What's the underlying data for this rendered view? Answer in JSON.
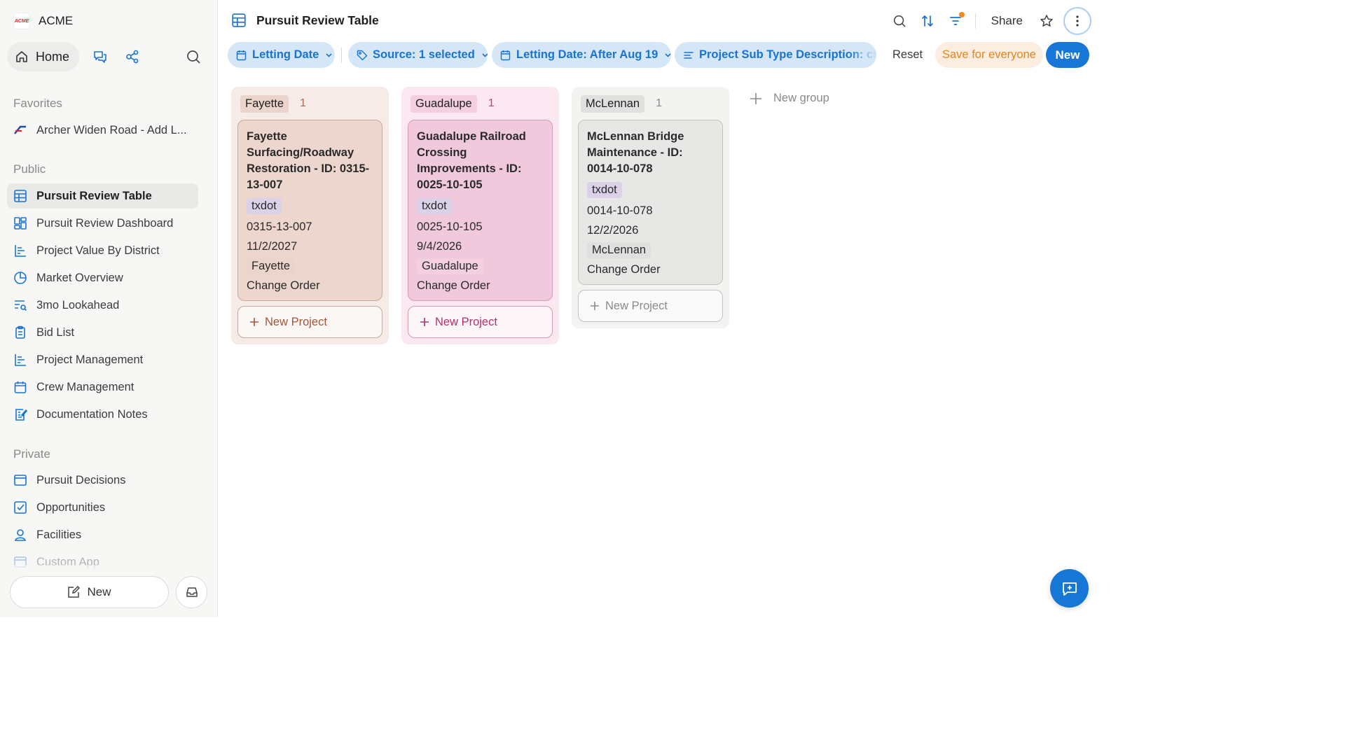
{
  "workspace": {
    "name": "ACME",
    "logo_text": "ACME"
  },
  "topnav": {
    "home_label": "Home"
  },
  "sidebar": {
    "favorites_label": "Favorites",
    "favorites": [
      {
        "label": "Archer Widen Road - Add L..."
      }
    ],
    "public_label": "Public",
    "public_items": [
      {
        "label": "Pursuit Review Table",
        "icon": "table-icon",
        "active": true
      },
      {
        "label": "Pursuit Review Dashboard",
        "icon": "dashboard-icon"
      },
      {
        "label": "Project Value By District",
        "icon": "chart-icon"
      },
      {
        "label": "Market Overview",
        "icon": "pie-chart-icon"
      },
      {
        "label": "3mo Lookahead",
        "icon": "list-search-icon"
      },
      {
        "label": "Bid List",
        "icon": "clipboard-icon"
      },
      {
        "label": "Project Management",
        "icon": "chart-icon"
      },
      {
        "label": "Crew Management",
        "icon": "calendar-icon"
      },
      {
        "label": "Documentation Notes",
        "icon": "note-edit-icon"
      }
    ],
    "private_label": "Private",
    "private_items": [
      {
        "label": "Pursuit Decisions",
        "icon": "window-icon"
      },
      {
        "label": "Opportunities",
        "icon": "checkbox-icon"
      },
      {
        "label": "Facilities",
        "icon": "location-person-icon"
      },
      {
        "label": "Custom App",
        "icon": "window-icon"
      }
    ],
    "new_label": "New"
  },
  "header": {
    "title": "Pursuit Review Table",
    "share_label": "Share"
  },
  "filters": {
    "chips": [
      {
        "label": "Letting Date"
      },
      {
        "label": "Source: 1 selected"
      },
      {
        "label": "Letting Date: After Aug 19"
      },
      {
        "label": "Project Sub Type Description: change"
      }
    ],
    "reset_label": "Reset",
    "save_label": "Save for everyone",
    "new_label": "New"
  },
  "board": {
    "groups": [
      {
        "name": "Fayette",
        "count": "1",
        "colors": {
          "bg": "#f6ebe6",
          "tag": "#ead4cb",
          "card": "#ecd6cd",
          "border": "#c9a89b",
          "count": "#a86a52",
          "accent": "#a0553b"
        },
        "card": {
          "title": "Fayette Surfacing/Roadway Restoration - ID: 0315-13-007",
          "source": "txdot",
          "project_id": "0315-13-007",
          "date": "11/2/2027",
          "county": "Fayette",
          "type": "Change Order"
        },
        "new_project_label": "New Project"
      },
      {
        "name": "Guadalupe",
        "count": "1",
        "colors": {
          "bg": "#fbe8f0",
          "tag": "#f3cfe0",
          "card": "#f1c9dc",
          "border": "#d79bb8",
          "count": "#c2407e",
          "accent": "#b2306f"
        },
        "card": {
          "title": "Guadalupe Railroad Crossing Improvements - ID: 0025-10-105",
          "source": "txdot",
          "project_id": "0025-10-105",
          "date": "9/4/2026",
          "county": "Guadalupe",
          "type": "Change Order"
        },
        "new_project_label": "New Project"
      },
      {
        "name": "McLennan",
        "count": "1",
        "colors": {
          "bg": "#f3f3f2",
          "tag": "#e0e0de",
          "card": "#e7e7e5",
          "border": "#c2c2c0",
          "count": "#8a8a88",
          "accent": "#8a8a88"
        },
        "card": {
          "title": "McLennan Bridge Maintenance - ID: 0014-10-078",
          "source": "txdot",
          "project_id": "0014-10-078",
          "date": "12/2/2026",
          "county": "McLennan",
          "type": "Change Order"
        },
        "new_project_label": "New Project"
      }
    ],
    "new_group_label": "New group"
  },
  "colors": {
    "accent": "#1677d6",
    "chip_bg": "#d5e6f7",
    "save_text": "#e8821c",
    "notification_dot": "#f28a1e",
    "source_tag": "#dbd2ea"
  }
}
